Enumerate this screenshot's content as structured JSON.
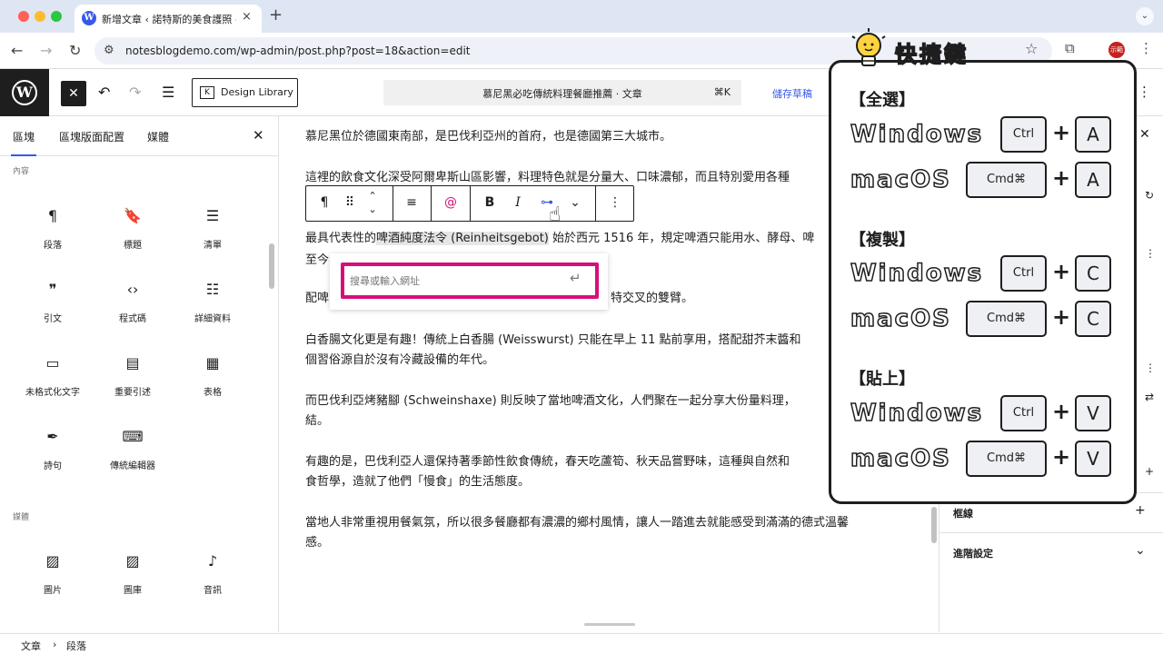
{
  "browser": {
    "tab_title": "新增文章 ‹ 諾特斯的美食護照 —",
    "tab_close": "×",
    "new_tab": "+",
    "tab_menu": "⌄",
    "url": "notesblogdemo.com/wp-admin/post.php?post=18&action=edit",
    "profile": "示範"
  },
  "header": {
    "design_library": "Design Library",
    "command_title": "慕尼黑必吃傳統料理餐廳推薦 · 文章",
    "command_shortcut": "⌘K",
    "save_draft": "儲存草稿"
  },
  "inserter": {
    "tabs": [
      "區塊",
      "區塊版面配置",
      "媒體"
    ],
    "categories": [
      "內容",
      "媒體"
    ],
    "text_blocks": [
      {
        "label": "段落",
        "icon": "¶"
      },
      {
        "label": "標題",
        "icon": "🔖"
      },
      {
        "label": "清單",
        "icon": "☰"
      },
      {
        "label": "引文",
        "icon": "❞"
      },
      {
        "label": "程式碼",
        "icon": "‹›"
      },
      {
        "label": "詳細資料",
        "icon": "☷"
      },
      {
        "label": "未格式化文字",
        "icon": "▭"
      },
      {
        "label": "重要引述",
        "icon": "▤"
      },
      {
        "label": "表格",
        "icon": "▦"
      },
      {
        "label": "詩句",
        "icon": "✒"
      },
      {
        "label": "傳統編輯器",
        "icon": "⌨"
      }
    ],
    "media_blocks": [
      {
        "label": "圖片",
        "icon": "▨"
      },
      {
        "label": "圖庫",
        "icon": "▨"
      },
      {
        "label": "音訊",
        "icon": "♪"
      }
    ]
  },
  "content": {
    "p1": "慕尼黑位於德國東南部，是巴伐利亞州的首府，也是德國第三大城市。",
    "p2": "這裡的飲食文化深受阿爾卑斯山區影響，料理特色就是分量大、口味濃郁，而且特別愛用各種",
    "p3_before": "最具代表性的",
    "p3_highlight": "啤酒純度法令 (Reinheitsgebot)",
    "p3_after": " 始於西元 1516 年，規定啤酒只能用水、酵母、啤",
    "p3_line2": "至今",
    "p4_start": "配啤",
    "p4_end": "特交叉的雙臂。",
    "p5": "白香腸文化更是有趣！傳統上白香腸 (Weisswurst) 只能在早上 11 點前享用，搭配甜芥末醬和",
    "p5_line2": "個習俗源自於沒有冷藏設備的年代。",
    "p6": "而巴伐利亞烤豬腳 (Schweinshaxe) 則反映了當地啤酒文化，人們聚在一起分享大份量料理，",
    "p6_line2": "結。",
    "p7": "有趣的是，巴伐利亞人還保持著季節性飲食傳統，春天吃蘆筍、秋天品嘗野味，這種與自然和",
    "p7_line2": "食哲學，造就了他們「慢食」的生活態度。",
    "p8": "當地人非常重視用餐氣氛，所以很多餐廳都有濃濃的鄉村風情，讓人一踏進去就能感受到滿滿的德式溫馨",
    "p8_line2": "感。"
  },
  "link_popover": {
    "placeholder": "搜尋或輸入網址",
    "value": ""
  },
  "settings": {
    "rows": [
      "框線",
      "進階設定"
    ]
  },
  "footer": {
    "crumb_root": "文章",
    "crumb_sep": "›",
    "crumb_current": "段落"
  },
  "shortcut_overlay": {
    "title": "快捷鍵",
    "sections": [
      {
        "heading": "【全選】",
        "windows": {
          "os": "Windows",
          "modifier": "Ctrl",
          "key": "A"
        },
        "mac": {
          "os": "macOS",
          "modifier": "Cmd⌘",
          "key": "A"
        }
      },
      {
        "heading": "【複製】",
        "windows": {
          "os": "Windows",
          "modifier": "Ctrl",
          "key": "C"
        },
        "mac": {
          "os": "macOS",
          "modifier": "Cmd⌘",
          "key": "C"
        }
      },
      {
        "heading": "【貼上】",
        "windows": {
          "os": "Windows",
          "modifier": "Ctrl",
          "key": "V"
        },
        "mac": {
          "os": "macOS",
          "modifier": "Cmd⌘",
          "key": "V"
        }
      }
    ],
    "plus": "+"
  },
  "colors": {
    "wp_accent": "#3858e9",
    "highlight_frame": "#d60f7a",
    "overlay_title": "#f5a623"
  }
}
